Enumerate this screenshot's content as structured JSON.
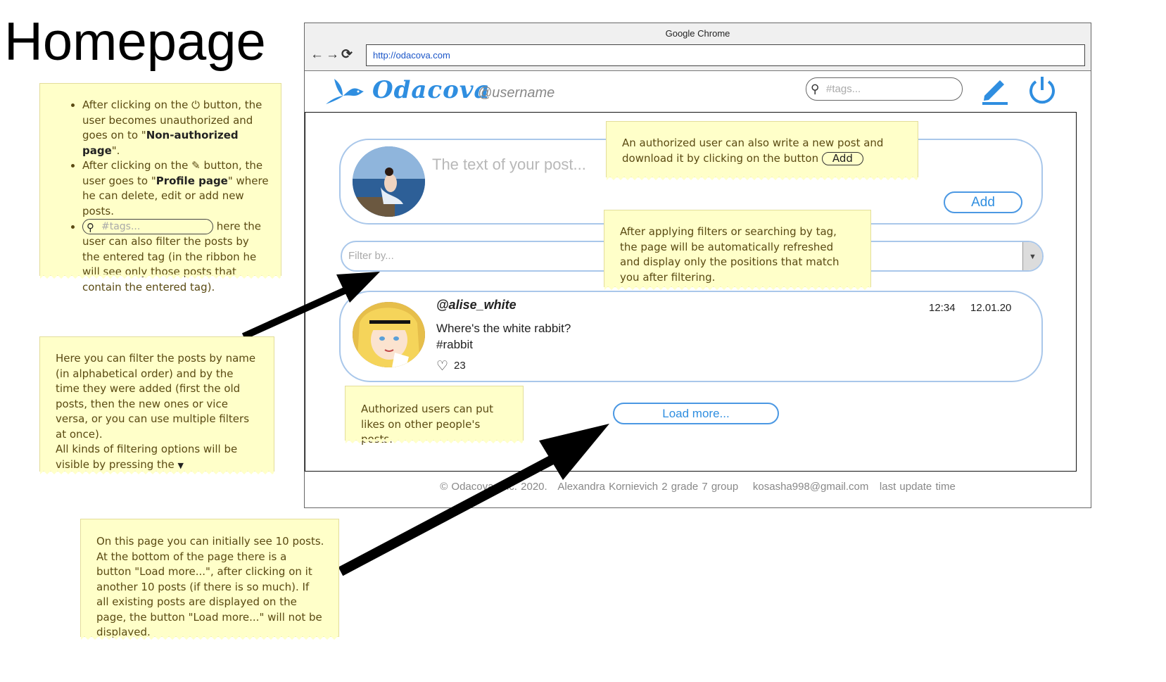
{
  "page_title": "Homepage",
  "browser": {
    "title": "Google Chrome",
    "nav_buttons": "←→⟳",
    "url": "http://odacova.com"
  },
  "app": {
    "logo": "Odacova",
    "username": "@username",
    "search_placeholder": "#tags..."
  },
  "composer": {
    "placeholder": "The text of your post...",
    "add_label": "Add"
  },
  "filter": {
    "placeholder": "Filter by..."
  },
  "post": {
    "author": "@alise_white",
    "time": "12:34",
    "date": "12.01.20",
    "text_line1": "Where's the white rabbit?",
    "text_line2": "#rabbit",
    "likes": "23"
  },
  "load_more_label": "Load more...",
  "footer": {
    "prefix": "© Odacova, Inc. 2020.",
    "author": "Alexandra Kornievich 2 grade 7 group",
    "email": "kosasha998@gmail.com",
    "update": "last update time"
  },
  "notes": {
    "topleft": {
      "b1_pre": "After clicking on the",
      "b1_mid": "button, the user becomes unauthorized and goes on to \"",
      "b1_bold": "Non-authorized page",
      "b1_post": "\".",
      "b2_pre": "After clicking on the",
      "b2_mid": "button, the user goes to \"",
      "b2_bold": "Profile page",
      "b2_post": "\" where he can delete, edit or add new posts.",
      "b3_search": "#tags...",
      "b3_post": "here the user can also filter the posts by the entered tag (in the ribbon he will see only those posts that contain the entered tag)."
    },
    "authorized_write": {
      "text": "An authorized user can also write a new post and download it by clicking on the button",
      "button": "Add"
    },
    "filters_applied": "After applying filters or searching by tag, the page will be automatically refreshed and display only the positions that match you after filtering.",
    "filter_by": {
      "text": "Here you can filter the posts by name (in alphabetical order) and by the time they were added (first the old posts, then the new ones or vice versa, or you can use multiple filters at once).",
      "text2": "All kinds of filtering options will be visible by pressing the"
    },
    "likes": "Authorized users can put likes on other people's posts.",
    "load_more": "On this page you can initially see 10 posts. At the bottom of the page there is a button \"Load more...\", after clicking on it another 10 posts (if there is so much). If all existing posts are displayed on the page, the button \"Load more...\" will not be displayed."
  },
  "colors": {
    "accent": "#2f8ee0",
    "note_bg": "#ffffc9",
    "card_border": "#a9c7ea"
  }
}
